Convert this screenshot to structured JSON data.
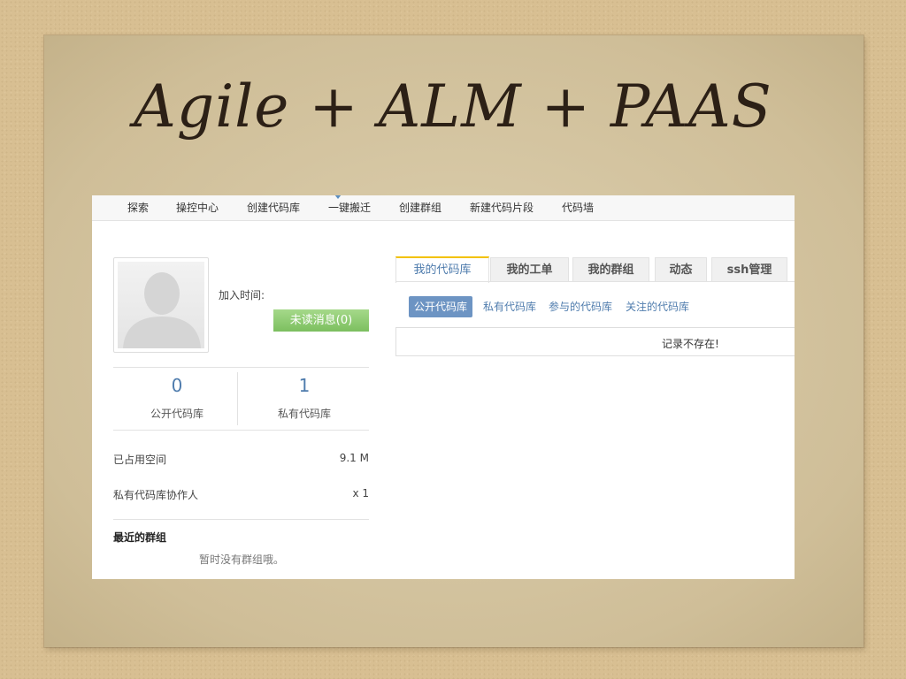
{
  "slide": {
    "title": "Agile + ALM + PAAS"
  },
  "nav": {
    "items": [
      {
        "label": "探索"
      },
      {
        "label": "操控中心"
      },
      {
        "label": "创建代码库"
      },
      {
        "label": "一键搬迁"
      },
      {
        "label": "创建群组"
      },
      {
        "label": "新建代码片段"
      },
      {
        "label": "代码墙"
      }
    ]
  },
  "profile": {
    "join_label": "加入时间:",
    "unread_button": "未读消息(0)"
  },
  "stats": {
    "public_count": "0",
    "public_label": "公开代码库",
    "private_count": "1",
    "private_label": "私有代码库"
  },
  "info": {
    "space_label": "已占用空间",
    "space_value": "9.1 M",
    "collab_label": "私有代码库协作人",
    "collab_value": "x 1"
  },
  "groups": {
    "title": "最近的群组",
    "empty": "暂时没有群组哦。"
  },
  "tabs": [
    {
      "label": "我的代码库"
    },
    {
      "label": "我的工单"
    },
    {
      "label": "我的群组"
    },
    {
      "label": "动态"
    },
    {
      "label": "ssh管理"
    }
  ],
  "subtabs": [
    {
      "label": "公开代码库"
    },
    {
      "label": "私有代码库"
    },
    {
      "label": "参与的代码库"
    },
    {
      "label": "关注的代码库"
    }
  ],
  "list": {
    "empty_text": "记录不存在!"
  },
  "colors": {
    "accent": "#4f7cad",
    "unread_green": "#7cbf5f",
    "tab_highlight": "#f2c200"
  }
}
